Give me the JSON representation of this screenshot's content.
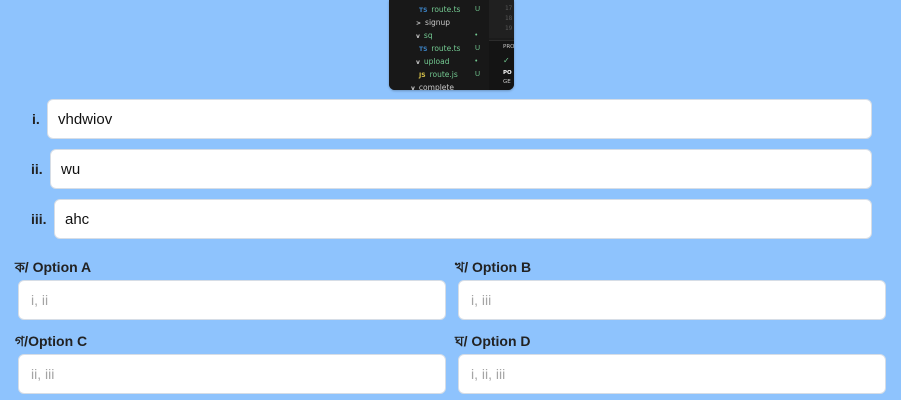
{
  "thumbnail": {
    "files": [
      {
        "icon": "TS",
        "name": "route.ts",
        "status": "U",
        "kind": "ts"
      },
      {
        "icon": ">",
        "name": "signup",
        "status": "",
        "kind": "folder"
      },
      {
        "icon": "v",
        "name": "sq",
        "status": "•",
        "kind": "folder"
      },
      {
        "icon": "TS",
        "name": "route.ts",
        "status": "U",
        "kind": "ts"
      },
      {
        "icon": "v",
        "name": "upload",
        "status": "•",
        "kind": "folder"
      },
      {
        "icon": "JS",
        "name": "route.js",
        "status": "U",
        "kind": "js"
      },
      {
        "icon": "v",
        "name": "complete",
        "status": "",
        "kind": "folder"
      }
    ],
    "line_numbers": [
      "17",
      "18",
      "19"
    ],
    "panel_title": "PROI",
    "panel_check": "✓",
    "panel_lines": [
      "PO",
      "GE"
    ]
  },
  "statements": [
    {
      "label": "i.",
      "value": "vhdwiov"
    },
    {
      "label": "ii.",
      "value": "wu"
    },
    {
      "label": "iii.",
      "value": "ahc"
    }
  ],
  "options": [
    {
      "label": "ক/ Option A",
      "placeholder": "i, ii"
    },
    {
      "label": "খ/ Option B",
      "placeholder": "i, iii"
    },
    {
      "label": "গ/Option C",
      "placeholder": "ii, iii"
    },
    {
      "label": "ঘ/ Option D",
      "placeholder": "i, ii, iii"
    }
  ]
}
